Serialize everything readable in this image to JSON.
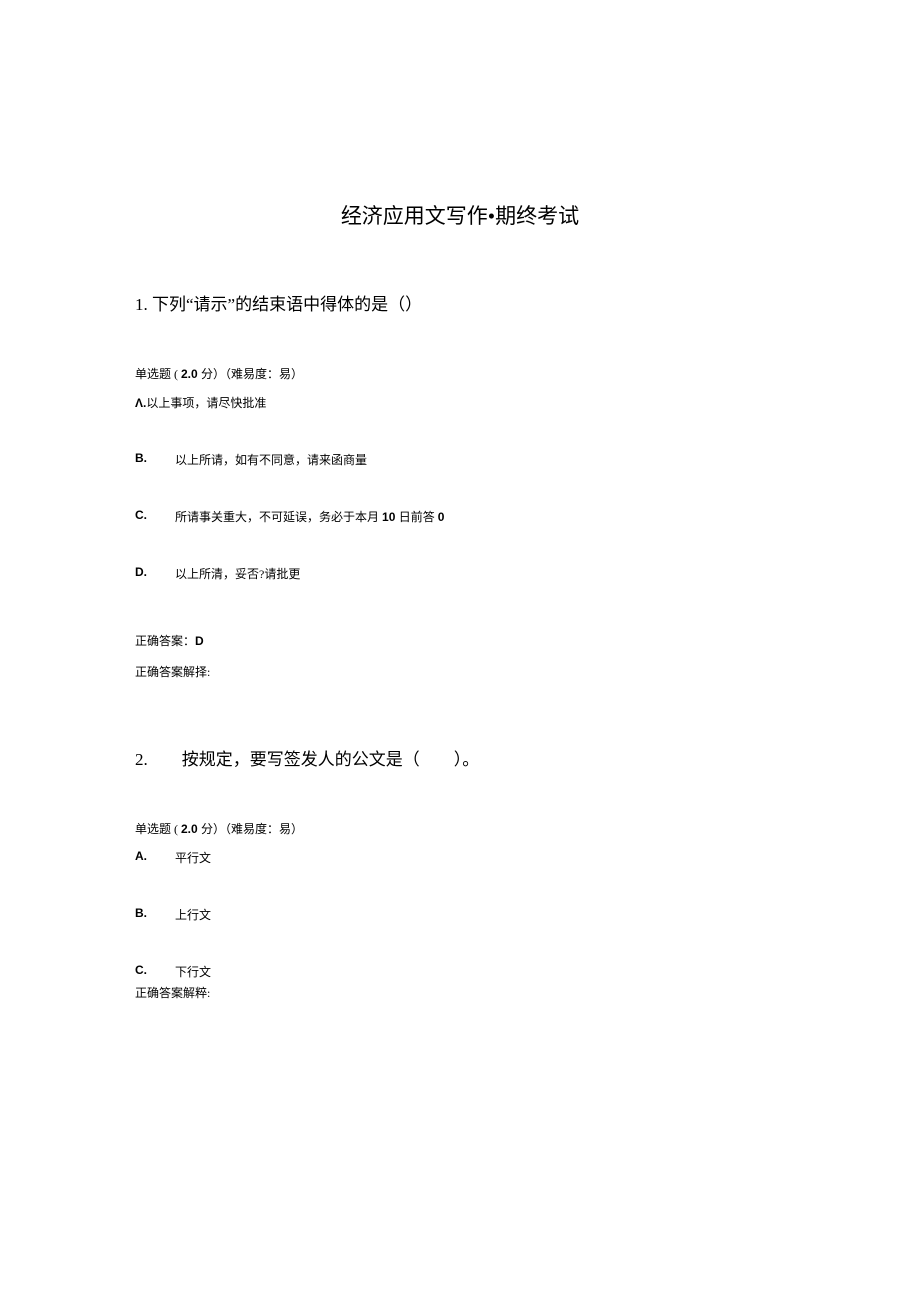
{
  "doc": {
    "title": "经济应用文写作•期终考试"
  },
  "q1": {
    "number": "1.",
    "title": "下列“请示”的结束语中得体的是（）",
    "meta_prefix": "单选题 ( ",
    "meta_points": "2.0 ",
    "meta_suffix": "分）（难易度：易）",
    "optA_label": "Λ.",
    "optA_text": "以上事项，请尽快批准",
    "optB_label": "B.",
    "optB_text": "以上所请，如有不同意，请来函商量",
    "optC_label": "C.",
    "optC_text_pre": "所请事关重大，不可延误，务必于本月 ",
    "optC_bold1": "10 ",
    "optC_mid": "日前答 ",
    "optC_bold2": "0",
    "optD_label": "D.",
    "optD_text": "以上所清，妥否?请批更",
    "answer_prefix": "正确答案：",
    "answer_value": "D",
    "explain_label": "正确答案解择:"
  },
  "q2": {
    "number": "2.",
    "title_spacer": "  ",
    "title": "按规定，要写签发人的公文是（  ）。",
    "meta_prefix": "单选题 ( ",
    "meta_points": "2.0 ",
    "meta_suffix": "分）（难易度：易）",
    "optA_label": "A.",
    "optA_text": "平行文",
    "optB_label": "B.",
    "optB_text": "上行文",
    "optC_label": "C.",
    "optC_text": "下行文",
    "explain_label": "正确答案解粹:"
  }
}
